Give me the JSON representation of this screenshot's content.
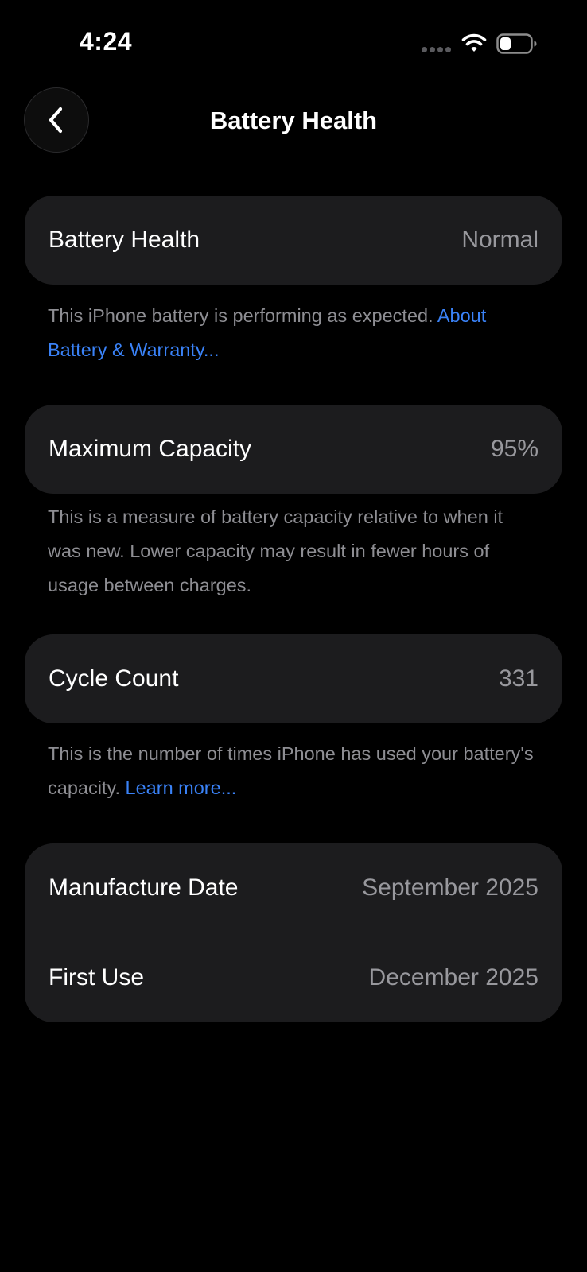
{
  "status_bar": {
    "time": "4:24",
    "wifi_icon": "wifi-icon",
    "battery_icon": "battery-icon"
  },
  "nav": {
    "title": "Battery Health",
    "back_icon": "chevron-left-icon"
  },
  "sections": {
    "health": {
      "label": "Battery Health",
      "value": "Normal",
      "footnote_text": "This iPhone battery is performing as expected. ",
      "footnote_link": "About Battery & Warranty..."
    },
    "capacity": {
      "label": "Maximum Capacity",
      "value": "95%",
      "footnote_text": "This is a measure of battery capacity relative to when it was new. Lower capacity may result in fewer hours of usage between charges."
    },
    "cycles": {
      "label": "Cycle Count",
      "value": "331",
      "footnote_text": "This is the number of times iPhone has used your battery's capacity. ",
      "footnote_link": "Learn more..."
    },
    "dates": {
      "manufacture_label": "Manufacture Date",
      "manufacture_value": "September 2025",
      "first_use_label": "First Use",
      "first_use_value": "December 2025"
    }
  },
  "colors": {
    "background": "#000000",
    "card": "#1c1c1e",
    "secondary_text": "#98989d",
    "link": "#3a82f7"
  }
}
